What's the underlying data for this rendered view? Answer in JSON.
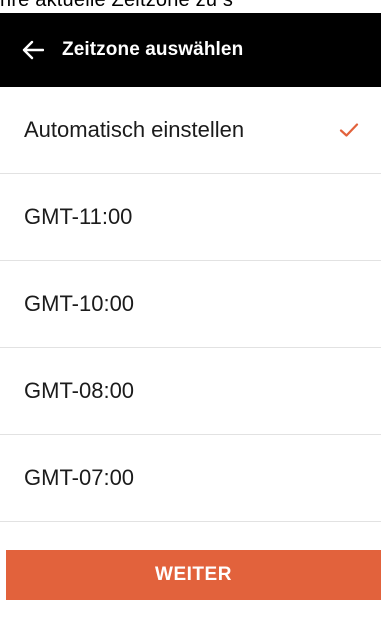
{
  "top_snippet": "hre aktuelle Zeitzone zu s",
  "header": {
    "title": "Zeitzone auswählen",
    "back_icon": "arrow-left-icon"
  },
  "list": {
    "items": [
      {
        "label": "Automatisch einstellen",
        "selected": true
      },
      {
        "label": "GMT-11:00",
        "selected": false
      },
      {
        "label": "GMT-10:00",
        "selected": false
      },
      {
        "label": "GMT-08:00",
        "selected": false
      },
      {
        "label": "GMT-07:00",
        "selected": false
      }
    ],
    "check_icon": "checkmark-icon"
  },
  "footer": {
    "button_label": "WEITER"
  },
  "colors": {
    "header_bg": "#000000",
    "accent": "#e2623c",
    "divider": "#e2e2e2",
    "text": "#1b1b1b"
  }
}
